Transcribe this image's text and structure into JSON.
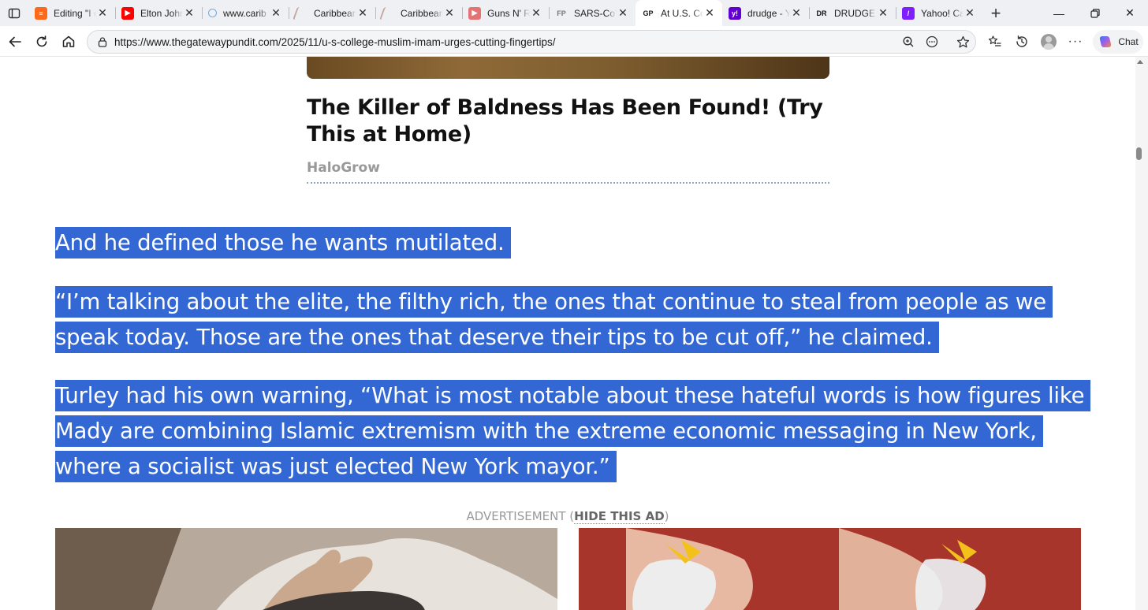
{
  "tabs": [
    {
      "title": "Editing \"I c",
      "icon": "substack-icon",
      "color": "#ff6719",
      "glyph": "≡"
    },
    {
      "title": "Elton John",
      "icon": "youtube-icon",
      "color": "#ff0000",
      "glyph": "▶"
    },
    {
      "title": "www.carib",
      "icon": "search-icon",
      "color": "#7aa8d8",
      "glyph": ""
    },
    {
      "title": "Caribbean",
      "icon": "caribbean-site-icon",
      "color": "#c9a0a0",
      "glyph": ""
    },
    {
      "title": "Caribbean",
      "icon": "caribbean-site-icon",
      "color": "#c9a0a0",
      "glyph": ""
    },
    {
      "title": "Guns N' R",
      "icon": "youtube-icon",
      "color": "#e57373",
      "glyph": "▶"
    },
    {
      "title": "SARS-CoV",
      "icon": "fp-icon",
      "color": "#777777",
      "glyph": "FP"
    },
    {
      "title": "At U.S. Col",
      "icon": "gp-icon",
      "color": "#1a1a1a",
      "glyph": "GP",
      "active": true
    },
    {
      "title": "drudge - Y",
      "icon": "yahoo-icon",
      "color": "#6001d2",
      "glyph": "y!"
    },
    {
      "title": "DRUDGE R",
      "icon": "drudge-icon",
      "color": "#111111",
      "glyph": "DR"
    },
    {
      "title": "Yahoo! Ca",
      "icon": "yahoo-icon",
      "color": "#7e1fff",
      "glyph": "/"
    }
  ],
  "address": {
    "url": "https://www.thegatewaypundit.com/2025/11/u-s-college-muslim-imam-urges-cutting-fingertips/"
  },
  "toolbar": {
    "chat_label": "Chat"
  },
  "ad_top": {
    "headline": "The Killer of Baldness Has Been Found! (Try This at Home)",
    "source": "HaloGrow"
  },
  "article": {
    "p1": "And he defined those he wants mutilated.",
    "p2": "“I’m talking about the elite, the filthy rich, the ones that continue to steal from people as we speak today. Those are the ones that deserve their tips to be cut off,” he claimed.",
    "p3": "Turley had his own warning, “What is most notable about these hateful words is how figures like Mady are combining Islamic extremism with the extreme economic messaging in New York, where a socialist was just elected New York mayor.”"
  },
  "advertisement": {
    "label": "ADVERTISEMENT",
    "hide_label": "HIDE THIS AD"
  },
  "colors": {
    "selection": "#3368d4",
    "tabstrip": "#eef0f3"
  }
}
